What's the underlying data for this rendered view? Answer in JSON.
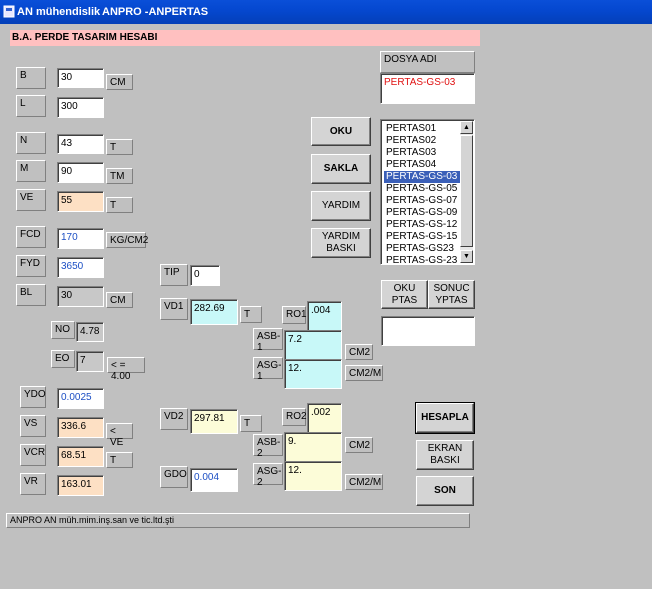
{
  "titlebar": {
    "app": "AN mühendislik",
    "module": "ANPRO  -ANPERTAS"
  },
  "header": {
    "title": "B.A. PERDE TASARIM HESABI"
  },
  "fields": {
    "B": {
      "label": "B",
      "value": "30",
      "unit": "CM"
    },
    "L": {
      "label": "L",
      "value": "300"
    },
    "N": {
      "label": "N",
      "value": "43",
      "unit": "T"
    },
    "M": {
      "label": "M",
      "value": "90",
      "unit": "TM"
    },
    "VE": {
      "label": "VE",
      "value": "55",
      "unit": "T"
    },
    "FCD": {
      "label": "FCD",
      "value": "170",
      "unit": "KG/CM2"
    },
    "FYD": {
      "label": "FYD",
      "value": "3650"
    },
    "BL": {
      "label": "BL",
      "value": "30",
      "unit": "CM"
    },
    "NO": {
      "label": "NO",
      "value": "4.78"
    },
    "EO": {
      "label": "EO",
      "value": "7",
      "unit": "< = 4.00"
    },
    "YDO": {
      "label": "YDO",
      "value": "0.0025"
    },
    "VS": {
      "label": "VS",
      "value": "336.6",
      "unit": "< VE"
    },
    "VCR": {
      "label": "VCR",
      "value": "68.51",
      "unit": "T"
    },
    "VR": {
      "label": "VR",
      "value": "163.01"
    },
    "TIP": {
      "label": "TIP",
      "value": "0"
    },
    "VD1": {
      "label": "VD1",
      "value": "282.69",
      "unit": "T"
    },
    "VD2": {
      "label": "VD2",
      "value": "297.81",
      "unit": "T"
    },
    "GDO": {
      "label": "GDO",
      "value": "0.004"
    },
    "RO1": {
      "label": "RO1",
      "value": ".004"
    },
    "ASB1": {
      "label": "ASB-1",
      "value": "7.2",
      "unit": "CM2"
    },
    "ASG1": {
      "label": "ASG-1",
      "value": "12.",
      "unit": "CM2/M"
    },
    "RO2": {
      "label": "RO2",
      "value": ".002"
    },
    "ASB2": {
      "label": "ASB-2",
      "value": "9.",
      "unit": "CM2"
    },
    "ASG2": {
      "label": "ASG-2",
      "value": "12.",
      "unit": "CM2/M"
    }
  },
  "dosya": {
    "label": "DOSYA ADI",
    "value": "PERTAS-GS-03"
  },
  "buttons": {
    "oku": "OKU",
    "sakla": "SAKLA",
    "yardim": "YARDIM",
    "yardim_baski_1": "YARDIM",
    "yardim_baski_2": "BASKI",
    "oku_ptas_1": "OKU",
    "oku_ptas_2": "PTAS",
    "sonuc_1": "SONUC",
    "sonuc_2": "YPTAS",
    "hesapla": "HESAPLA",
    "ekran_baski": "EKRAN BASKI",
    "son": "SON"
  },
  "filelist": {
    "items": [
      "PERTAS01",
      "PERTAS02",
      "PERTAS03",
      "PERTAS04",
      "PERTAS-GS-03",
      "PERTAS-GS-05",
      "PERTAS-GS-07",
      "PERTAS-GS-09",
      "PERTAS-GS-12",
      "PERTAS-GS-15",
      "PERTAS-GS23",
      "PERTAS-GS-23"
    ],
    "selected_index": 4
  },
  "status": {
    "text": "ANPRO    AN müh.mim.inş.san ve tic.ltd.şti"
  },
  "colors": {
    "titlebar": "#0548d0",
    "header_bg": "#ffc0c0",
    "input_blue_text": "#1c4fc4",
    "red_text": "#e01010",
    "peach": "#fde0c4",
    "cyan": "#c8f8f8",
    "cream": "#fcfcd8",
    "selection": "#3a5fb8"
  }
}
